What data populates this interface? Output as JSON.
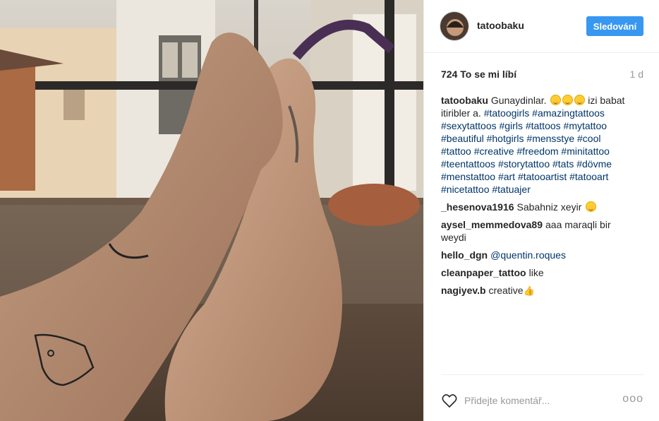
{
  "post": {
    "username": "tatoobaku",
    "follow_label": "Sledování",
    "likes_text": "724 To se mi líbí",
    "time_ago": "1 d"
  },
  "caption": {
    "user": "tatoobaku",
    "text_before": "Gunaydinlar.",
    "text_after": "izi babat itiribler a.",
    "hashtags": "#tatoogirls #amazingtattoos #sexytattoos #girls #tattoos #mytattoo #beautiful #hotgirls #mensstye #cool #tattoo #creative #freedom #minitattoo #teentattoos #storytattoo #tats #dövme #menstattoo #art #tatooartist #tatooart #nicetattoo #tatuajer"
  },
  "comments": [
    {
      "user": "_hesenova1916",
      "text": "Sabahniz xeyir",
      "emoji": "smile"
    },
    {
      "user": "aysel_memmedova89",
      "text": "aaa maraqli bir weydi"
    },
    {
      "user": "hello_dgn",
      "mention": "@quentin.roques"
    },
    {
      "user": "cleanpaper_tattoo",
      "text": "like"
    },
    {
      "user": "nagiyev.b",
      "text": "creative",
      "emoji": "thumbs-up"
    }
  ],
  "footer": {
    "comment_placeholder": "Přidejte komentář...",
    "more_label": "ooo"
  },
  "colors": {
    "follow_button": "#3897f0",
    "hashtag": "#003569",
    "muted": "#999999"
  },
  "icons": {
    "like": "heart-icon",
    "options": "more-options-icon"
  }
}
